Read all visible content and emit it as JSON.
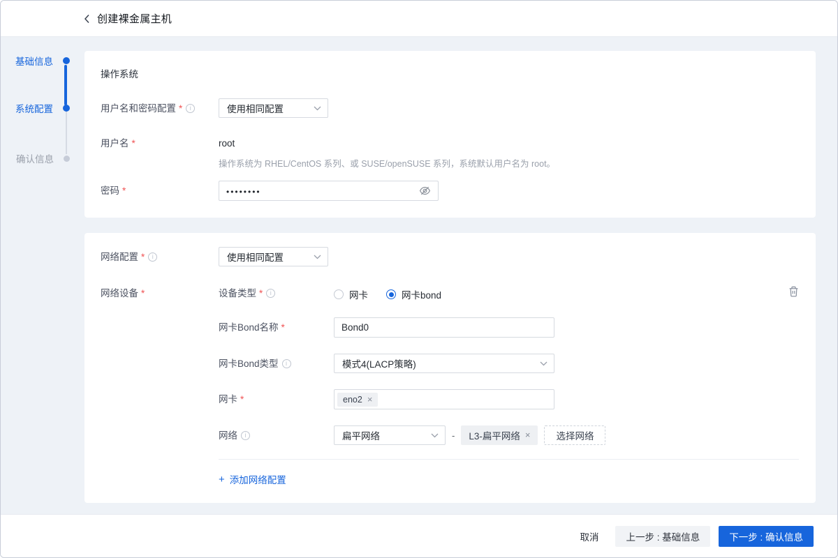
{
  "window": {
    "title": "创建裸金属主机"
  },
  "symbols": {
    "required": "*",
    "info": "i",
    "dash": "-",
    "plus": "+",
    "close": "×"
  },
  "steps": {
    "items": [
      {
        "label": "基础信息",
        "state": "done"
      },
      {
        "label": "系统配置",
        "state": "active"
      },
      {
        "label": "确认信息",
        "state": "pending"
      }
    ]
  },
  "os_card": {
    "section_title": "操作系统",
    "cred_label": "用户名和密码配置",
    "cred_value": "使用相同配置",
    "username_label": "用户名",
    "username_value": "root",
    "username_hint": "操作系统为 RHEL/CentOS 系列、或 SUSE/openSUSE 系列，系统默认用户名为 root。",
    "password_label": "密码",
    "password_value": "••••••••"
  },
  "net_card": {
    "config_label": "网络配置",
    "config_value": "使用相同配置",
    "device_label": "网络设备",
    "device_type_label": "设备类型",
    "radio_nic": "网卡",
    "radio_bond": "网卡bond",
    "radio_selected": "网卡bond",
    "bond_name_label": "网卡Bond名称",
    "bond_name_value": "Bond0",
    "bond_type_label": "网卡Bond类型",
    "bond_type_value": "模式4(LACP策略)",
    "nic_label": "网卡",
    "nic_tag": "eno2",
    "network_label": "网络",
    "network_type_value": "扁平网络",
    "network_tag": "L3-扁平网络",
    "select_network_button": "选择网络",
    "add_network_label": "添加网络配置"
  },
  "footer": {
    "cancel": "取消",
    "prev": "上一步 : 基础信息",
    "next": "下一步 : 确认信息"
  },
  "colors": {
    "primary": "#1765dc",
    "page_bg": "#eef2f7",
    "required_red": "#f05354"
  }
}
